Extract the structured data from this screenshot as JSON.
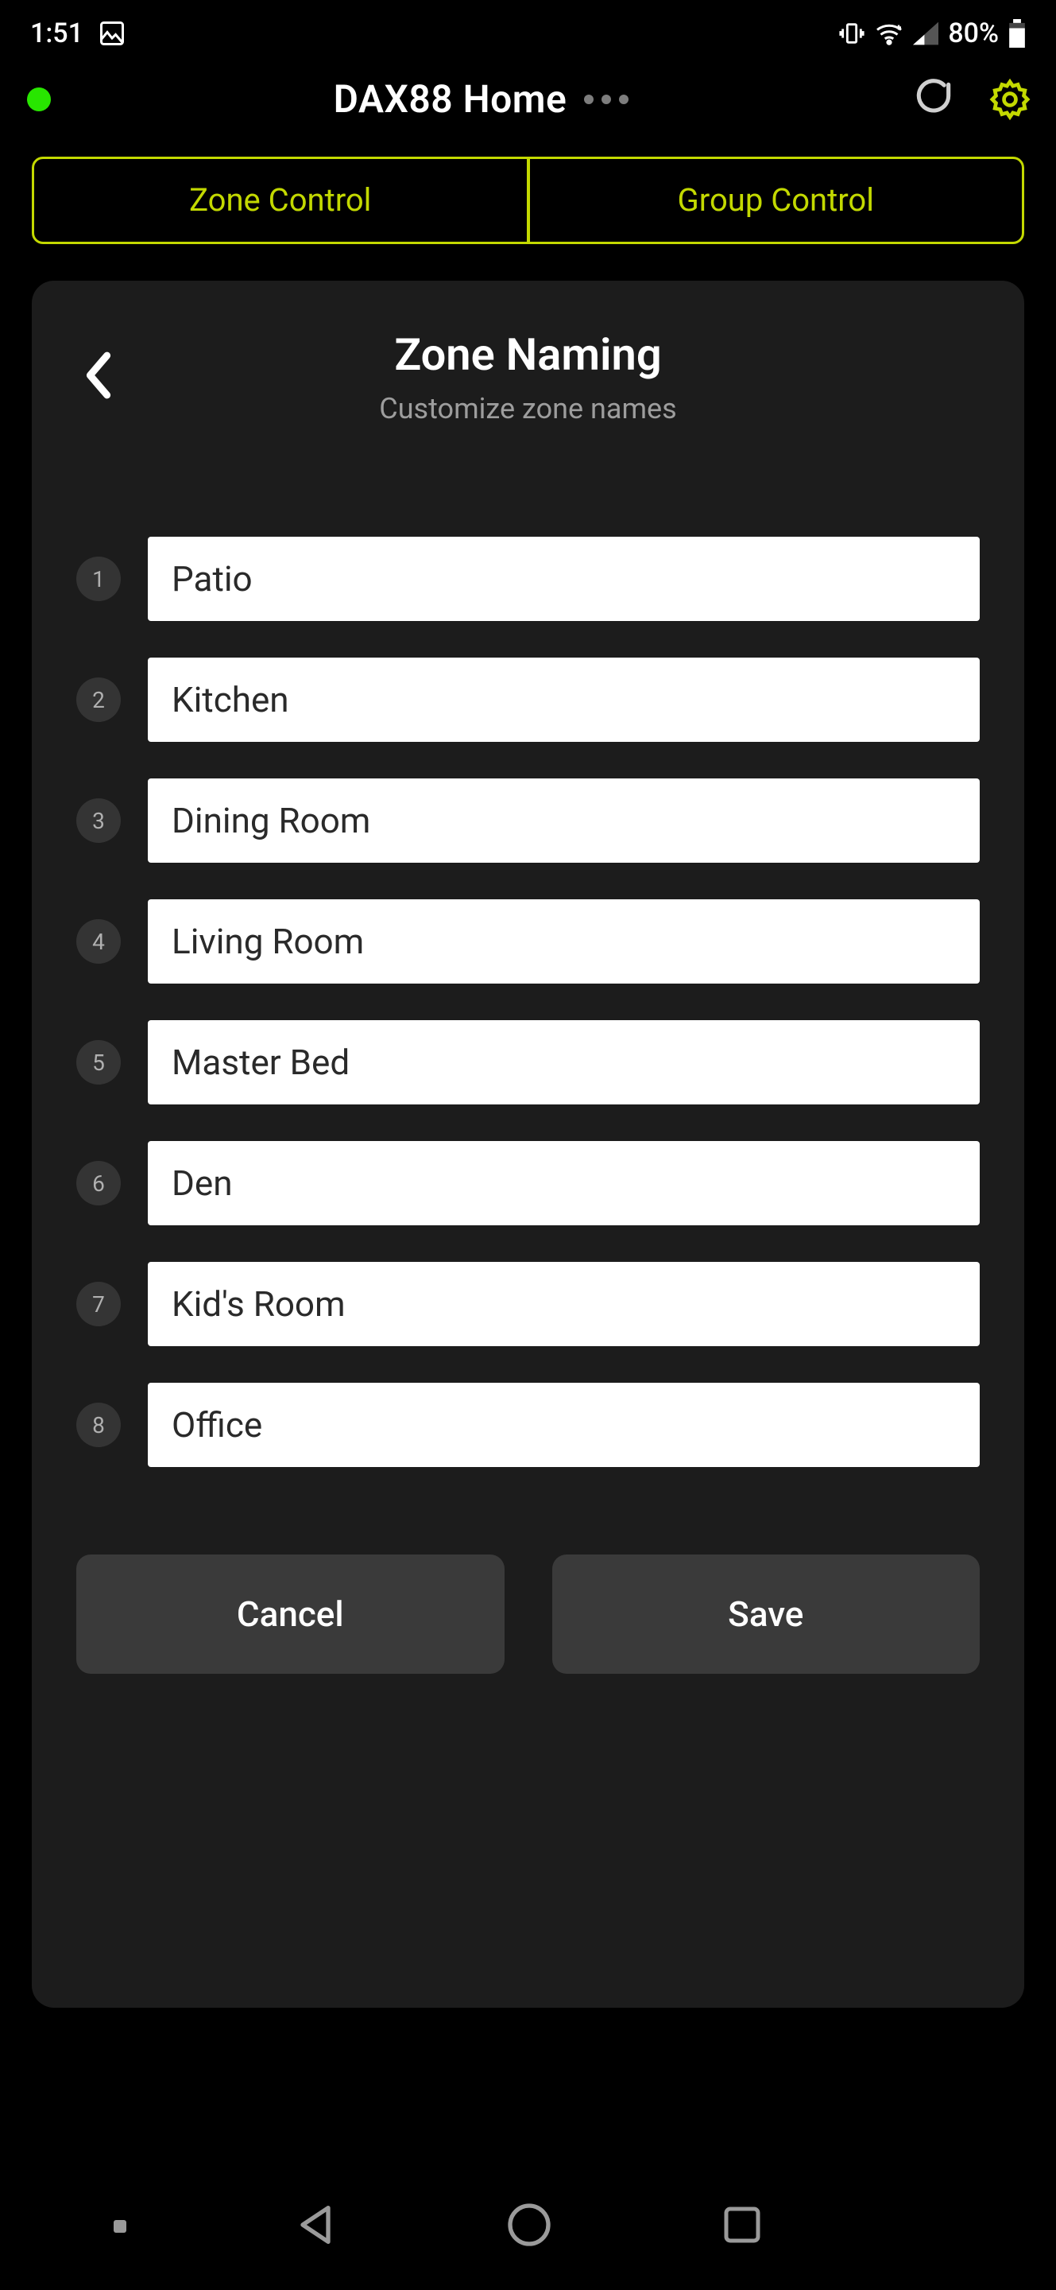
{
  "status_bar": {
    "time": "1:51",
    "battery_pct": "80%"
  },
  "header": {
    "title": "DAX88 Home"
  },
  "tabs": {
    "zone": "Zone Control",
    "group": "Group Control"
  },
  "panel": {
    "title": "Zone Naming",
    "subtitle": "Customize zone names"
  },
  "zones": [
    {
      "n": "1",
      "name": "Patio"
    },
    {
      "n": "2",
      "name": "Kitchen"
    },
    {
      "n": "3",
      "name": "Dining Room"
    },
    {
      "n": "4",
      "name": "Living Room"
    },
    {
      "n": "5",
      "name": "Master Bed"
    },
    {
      "n": "6",
      "name": "Den"
    },
    {
      "n": "7",
      "name": "Kid's Room"
    },
    {
      "n": "8",
      "name": "Office"
    }
  ],
  "buttons": {
    "cancel": "Cancel",
    "save": "Save"
  }
}
